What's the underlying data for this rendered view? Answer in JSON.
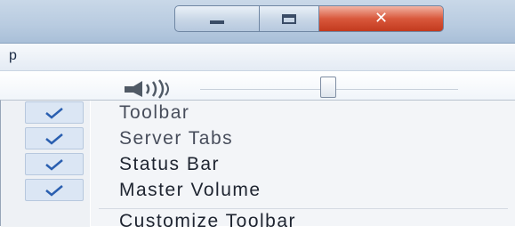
{
  "window": {
    "caption_buttons": {
      "minimize_icon": "minimize-icon",
      "maximize_icon": "maximize-icon",
      "close_icon": "close-icon",
      "close_glyph": "✕"
    }
  },
  "menubar": {
    "partial_label": "p"
  },
  "toolbar": {
    "volume_icon": "speaker-volume-icon",
    "volume_slider_icon": "volume-slider-thumb"
  },
  "context_menu": {
    "items": [
      {
        "label": "Toolbar",
        "checked": true
      },
      {
        "label": "Server Tabs",
        "checked": true
      },
      {
        "label": "Status Bar",
        "checked": true
      },
      {
        "label": "Master Volume",
        "checked": true
      },
      {
        "label": "Customize Toolbar",
        "checked": false
      }
    ]
  },
  "colors": {
    "close_button": "#d9583c",
    "check_highlight": "#dbe6f4",
    "check_mark": "#2a5fb0",
    "menu_background": "#f3f5f8"
  }
}
